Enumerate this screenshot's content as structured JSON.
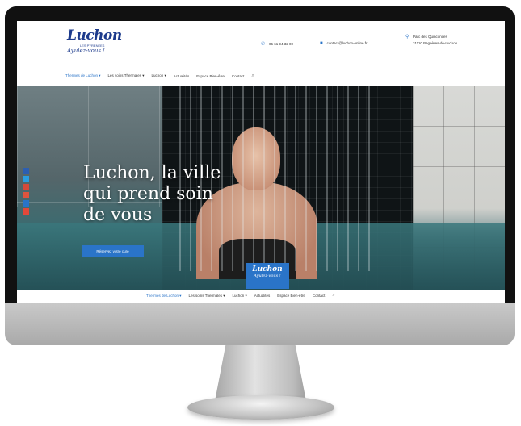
{
  "header": {
    "logo": {
      "word": "Luchon",
      "sub": "LES PYRÉNÉES",
      "tagline": "Ayulez-vous !"
    },
    "phone": "05 61 94 32 00",
    "email": "contact@luchon-online.fr",
    "address_lines": [
      "Parc des Quinconces",
      "31110 Bagnères-de-Luchon"
    ]
  },
  "nav": {
    "items": [
      {
        "label": "Thermes de Luchon ▾",
        "active": true
      },
      {
        "label": "Les soins Thermales ▾",
        "active": false
      },
      {
        "label": "Luchon ▾",
        "active": false
      },
      {
        "label": "Actualités",
        "active": false
      },
      {
        "label": "Espace Bien-être",
        "active": false
      },
      {
        "label": "Contact",
        "active": false
      }
    ],
    "search_icon": "search-icon"
  },
  "hero": {
    "title_lines": [
      "Luchon, la ville",
      "qui prend soin",
      "de vous"
    ],
    "cta_label": "Réservez votre cure",
    "badge": {
      "word": "Luchon",
      "tagline": "Ayulez-vous !"
    }
  },
  "social": [
    "facebook-icon",
    "twitter-icon",
    "google-plus-icon",
    "pinterest-icon",
    "linkedin-icon",
    "email-icon"
  ],
  "sticky_nav": {
    "items": [
      "Thermes de Luchon ▾",
      "Les soins Thermales ▾",
      "Luchon ▾",
      "Actualités",
      "Espace Bien-être",
      "Contact"
    ]
  },
  "colors": {
    "accent": "#2a74c8",
    "brand": "#1d3b8c",
    "monitor_frame": "#111111",
    "monitor_chin": "#b9b9b9"
  }
}
